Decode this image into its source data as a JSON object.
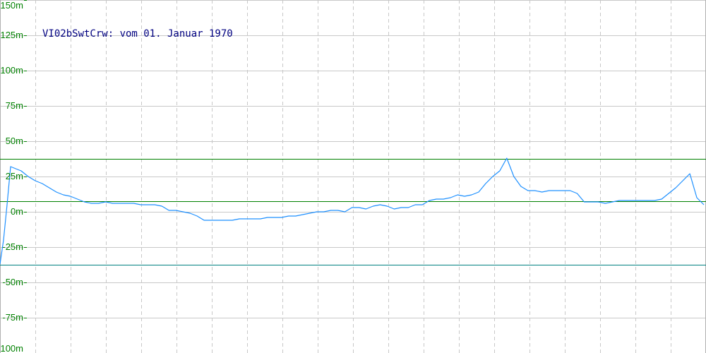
{
  "chart_data": {
    "type": "line",
    "title": "VI02bSwtCrw: vom 01. Januar 1970",
    "xlabel": "",
    "ylabel": "",
    "ylim": [
      -100,
      150
    ],
    "y_unit": "m",
    "y_ticks": [
      150,
      125,
      100,
      75,
      50,
      25,
      0,
      -25,
      -50,
      -75,
      -100
    ],
    "y_tick_labels": [
      "150m",
      "125m",
      "100m",
      "75m",
      "50m",
      "25m",
      "0m",
      "-25m",
      "-50m",
      "-75m",
      "-100m"
    ],
    "grid": true,
    "x_grid_count": 20,
    "reference_lines": [
      {
        "value": 37.5,
        "color": "#008000"
      },
      {
        "value": 7.5,
        "color": "#008000"
      },
      {
        "value": -37.5,
        "color": "#008080"
      }
    ],
    "series": [
      {
        "color": "#1e90ff",
        "x": [
          0,
          0.5,
          1,
          1.5,
          2,
          3,
          4,
          5,
          6,
          7,
          8,
          9,
          10,
          11,
          12,
          13,
          14,
          15,
          16,
          17,
          18,
          19,
          20,
          21,
          22,
          23,
          24,
          25,
          26,
          27,
          28,
          29,
          30,
          31,
          32,
          33,
          34,
          35,
          36,
          37,
          38,
          39,
          40,
          41,
          42,
          43,
          44,
          45,
          46,
          47,
          48,
          49,
          50,
          51,
          52,
          53,
          54,
          55,
          56,
          57,
          58,
          59,
          60,
          61,
          62,
          63,
          64,
          65,
          66,
          67,
          68,
          69,
          70,
          71,
          72,
          73,
          74,
          75,
          76,
          77,
          78,
          79,
          80,
          81,
          82,
          83,
          84,
          85,
          86,
          87,
          88,
          89,
          90,
          91,
          92,
          93,
          94,
          95,
          96,
          97,
          98,
          99,
          100
        ],
        "y": [
          -37,
          -20,
          5,
          32,
          31,
          29,
          25,
          22,
          20,
          17,
          14,
          12,
          11,
          9,
          7,
          6,
          6,
          7,
          6,
          6,
          6,
          6,
          5,
          5,
          5,
          4,
          1,
          1,
          0,
          -1,
          -3,
          -6,
          -6,
          -6,
          -6,
          -6,
          -5,
          -5,
          -5,
          -5,
          -4,
          -4,
          -4,
          -3,
          -3,
          -2,
          -1,
          0,
          0,
          1,
          1,
          0,
          3,
          3,
          2,
          4,
          5,
          4,
          2,
          3,
          3,
          5,
          5,
          8,
          9,
          9,
          10,
          12,
          11,
          12,
          14,
          20,
          25,
          29,
          38,
          25,
          18,
          15,
          15,
          14,
          15,
          15,
          15,
          15,
          13,
          7,
          7,
          7,
          6,
          7,
          8,
          8,
          8,
          8,
          8,
          8,
          9,
          13,
          17,
          22,
          27,
          10,
          5
        ]
      }
    ]
  }
}
